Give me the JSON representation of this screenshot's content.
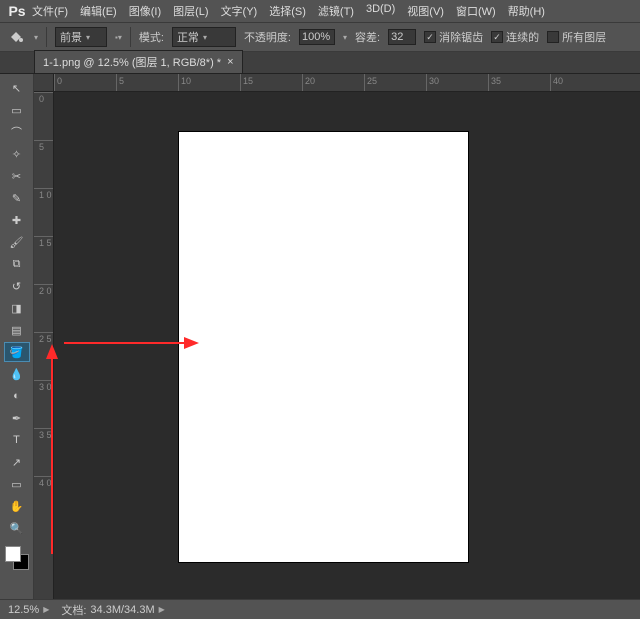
{
  "menubar": {
    "logo": "Ps",
    "items": [
      "文件(F)",
      "编辑(E)",
      "图像(I)",
      "图层(L)",
      "文字(Y)",
      "选择(S)",
      "滤镜(T)",
      "3D(D)",
      "视图(V)",
      "窗口(W)",
      "帮助(H)"
    ]
  },
  "options": {
    "tool_icon": "bucket",
    "fill_source": "前景",
    "mode_label": "模式:",
    "mode_value": "正常",
    "opacity_label": "不透明度:",
    "opacity_value": "100%",
    "tolerance_label": "容差:",
    "tolerance_value": "32",
    "antialias_label": "消除锯齿",
    "antialias_checked": true,
    "contiguous_label": "连续的",
    "contiguous_checked": true,
    "all_layers_label": "所有图层",
    "all_layers_checked": false
  },
  "tab": {
    "title": "1-1.png @ 12.5% (图层 1, RGB/8*) *",
    "close": "×"
  },
  "rulers": {
    "h": [
      "0",
      "5",
      "10",
      "15",
      "20",
      "25",
      "30",
      "35",
      "40"
    ],
    "v": [
      "0",
      "5",
      "1\n0",
      "1\n5",
      "2\n0",
      "2\n5",
      "3\n0",
      "3\n5",
      "4\n0"
    ]
  },
  "tools": {
    "items": [
      {
        "name": "move",
        "glyph": "↖"
      },
      {
        "name": "marquee",
        "glyph": "▭"
      },
      {
        "name": "lasso",
        "glyph": "⌒"
      },
      {
        "name": "wand",
        "glyph": "✧"
      },
      {
        "name": "crop",
        "glyph": "✂"
      },
      {
        "name": "eyedropper",
        "glyph": "✎"
      },
      {
        "name": "healing",
        "glyph": "✚"
      },
      {
        "name": "brush",
        "glyph": "🖌"
      },
      {
        "name": "stamp",
        "glyph": "⧉"
      },
      {
        "name": "history-brush",
        "glyph": "↺"
      },
      {
        "name": "eraser",
        "glyph": "◨"
      },
      {
        "name": "gradient",
        "glyph": "▤"
      },
      {
        "name": "bucket",
        "glyph": "🪣",
        "selected": true
      },
      {
        "name": "blur",
        "glyph": "💧"
      },
      {
        "name": "dodge",
        "glyph": "◐"
      },
      {
        "name": "pen",
        "glyph": "✒"
      },
      {
        "name": "type",
        "glyph": "T"
      },
      {
        "name": "path",
        "glyph": "↗"
      },
      {
        "name": "shape",
        "glyph": "▭"
      },
      {
        "name": "hand",
        "glyph": "✋"
      },
      {
        "name": "zoom",
        "glyph": "🔍"
      }
    ]
  },
  "statusbar": {
    "zoom": "12.5%",
    "doc_label": "文档:",
    "doc_value": "34.3M/34.3M"
  }
}
